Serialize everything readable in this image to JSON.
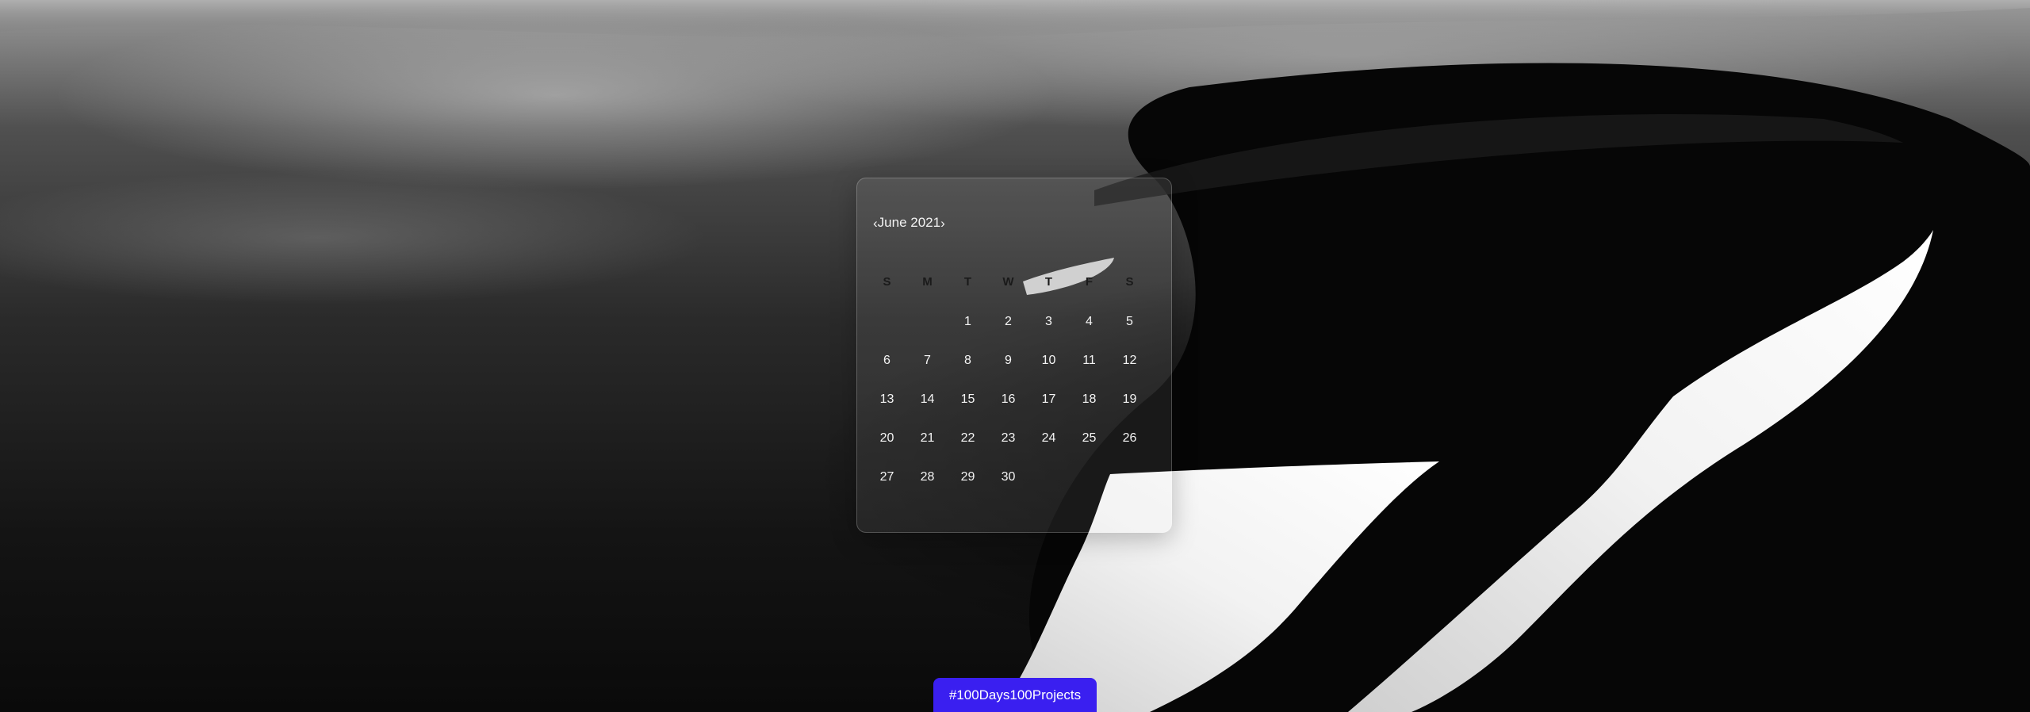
{
  "calendar": {
    "prev_icon": "‹",
    "next_icon": "›",
    "month_year": "June 2021",
    "weekdays": [
      "S",
      "M",
      "T",
      "W",
      "T",
      "F",
      "S"
    ],
    "days": [
      "",
      "",
      "1",
      "2",
      "3",
      "4",
      "5",
      "6",
      "7",
      "8",
      "9",
      "10",
      "11",
      "12",
      "13",
      "14",
      "15",
      "16",
      "17",
      "18",
      "19",
      "20",
      "21",
      "22",
      "23",
      "24",
      "25",
      "26",
      "27",
      "28",
      "29",
      "30",
      "",
      "",
      ""
    ]
  },
  "footer": {
    "tag_label": "#100Days100Projects",
    "accent_color": "#3a1ff0"
  }
}
